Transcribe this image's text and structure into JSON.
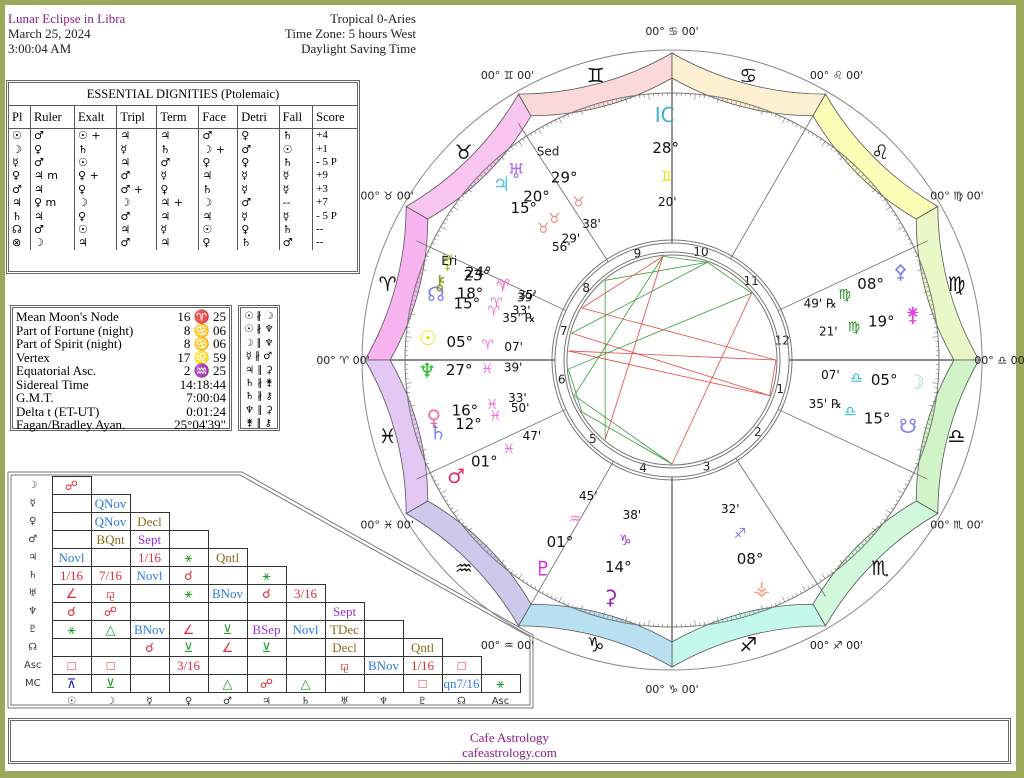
{
  "header": {
    "title": "Lunar Eclipse in Libra",
    "date": "March 25, 2024",
    "time": "3:00:04 AM",
    "zodiac": "Tropical 0-Aries",
    "timezone": "Time Zone: 5 hours West",
    "dst": "Daylight Saving Time"
  },
  "dignities": {
    "title": "ESSENTIAL DIGNITIES  (Ptolemaic)",
    "columns": [
      "Pl",
      "Ruler",
      "Exalt",
      "Tripl",
      "Term",
      "Face",
      "Detri",
      "Fall",
      "Score"
    ],
    "rows": [
      [
        "☉",
        "♂",
        "☉ +",
        "♃",
        "♃",
        "♂",
        "♀",
        "♄",
        "+4"
      ],
      [
        "☽",
        "♀",
        "♄",
        "☿",
        "♄",
        "☽ +",
        "♂",
        "☉",
        "+1"
      ],
      [
        "☿",
        "♂",
        "☉",
        "♃",
        "♂",
        "♀",
        "♀",
        "♄",
        "- 5 P"
      ],
      [
        "♀",
        "♃ m",
        "♀ +",
        "♂",
        "☿",
        "♃",
        "☿",
        "☿",
        "+9"
      ],
      [
        "♂",
        "♃",
        "♀",
        "♂ +",
        "♀",
        "♄",
        "☿",
        "☿",
        "+3"
      ],
      [
        "♃",
        "♀ m",
        "☽",
        "☽",
        "♃ +",
        "☽",
        "♂",
        "--",
        "+7"
      ],
      [
        "♄",
        "♃",
        "♀",
        "♂",
        "♃",
        "♃",
        "☿",
        "☿",
        "- 5 P"
      ],
      [
        "☊",
        "♂",
        "☉",
        "♃",
        "☿",
        "☉",
        "♀",
        "♄",
        "--"
      ],
      [
        "⊗",
        "☽",
        "♃",
        "♂",
        "♃",
        "♀",
        "♄",
        "♂",
        "--"
      ]
    ]
  },
  "info": [
    {
      "label": "Mean Moon's Node",
      "value": "16 ♈ 25"
    },
    {
      "label": "Part of Fortune (night)",
      "value": "8 ♋ 06"
    },
    {
      "label": "Part of Spirit (night)",
      "value": "8 ♋ 06"
    },
    {
      "label": "Vertex",
      "value": "17 ♌ 59"
    },
    {
      "label": "Equatorial Asc.",
      "value": "2 ♒ 25"
    },
    {
      "label": "Sidereal Time",
      "value": "14:18:44"
    },
    {
      "label": "G.M.T.",
      "value": "7:00:04"
    },
    {
      "label": "Delta t (ET-UT)",
      "value": "0:01:24"
    },
    {
      "label": "Fagan/Bradley Ayan.",
      "value": "25°04'39\""
    }
  ],
  "parallels": [
    "☉ ∦ ☽",
    "☉ ∦ ♆",
    "☽ ∥ ♆",
    "☿ ∦ ♂",
    "♃ ∥ ⚳",
    "♄ ∦ ⚵",
    "♄ ∦ ⚷",
    "♆ ∥ ⚳",
    "⚵ ∥ ⚷"
  ],
  "aspect_grid": {
    "row_labels": [
      "☽",
      "☿",
      "♀",
      "♂",
      "♃",
      "♄",
      "♅",
      "♆",
      "♇",
      "☊",
      "Asc",
      "MC"
    ],
    "col_labels": [
      "☉",
      "☽",
      "☿",
      "♀",
      "♂",
      "♃",
      "♄",
      "♅",
      "♆",
      "♇",
      "☊",
      "Asc"
    ],
    "cells": [
      [
        {
          "t": "☍",
          "c": "red"
        }
      ],
      [
        {
          "t": ""
        },
        {
          "t": "QNov",
          "c": "blu"
        }
      ],
      [
        {
          "t": ""
        },
        {
          "t": "QNov",
          "c": "blu"
        },
        {
          "t": "Decl",
          "c": "brn"
        }
      ],
      [
        {
          "t": ""
        },
        {
          "t": "BQnt",
          "c": "brn"
        },
        {
          "t": "Sept",
          "c": "pur"
        },
        {
          "t": ""
        }
      ],
      [
        {
          "t": "Novl",
          "c": "blu"
        },
        {
          "t": ""
        },
        {
          "t": "1/16",
          "c": "red"
        },
        {
          "t": "⚹",
          "c": "grn"
        },
        {
          "t": "Qntl",
          "c": "brn"
        }
      ],
      [
        {
          "t": "1/16",
          "c": "red"
        },
        {
          "t": "7/16",
          "c": "red"
        },
        {
          "t": "Novl",
          "c": "blu"
        },
        {
          "t": "☌",
          "c": "red"
        },
        {
          "t": ""
        },
        {
          "t": "⚹",
          "c": "grn"
        }
      ],
      [
        {
          "t": "∠",
          "c": "red"
        },
        {
          "t": "⚼",
          "c": "red"
        },
        {
          "t": ""
        },
        {
          "t": "⚹",
          "c": "grn"
        },
        {
          "t": "BNov",
          "c": "blu"
        },
        {
          "t": "☌",
          "c": "red"
        },
        {
          "t": "3/16",
          "c": "red"
        }
      ],
      [
        {
          "t": "☌",
          "c": "red"
        },
        {
          "t": "☍",
          "c": "red"
        },
        {
          "t": ""
        },
        {
          "t": ""
        },
        {
          "t": ""
        },
        {
          "t": ""
        },
        {
          "t": ""
        },
        {
          "t": "Sept",
          "c": "pur"
        }
      ],
      [
        {
          "t": "⚹",
          "c": "grn"
        },
        {
          "t": "△",
          "c": "grn"
        },
        {
          "t": "BNov",
          "c": "blu"
        },
        {
          "t": "∠",
          "c": "red"
        },
        {
          "t": "⊻",
          "c": "grn"
        },
        {
          "t": "BSep",
          "c": "pur"
        },
        {
          "t": "Novl",
          "c": "blu"
        },
        {
          "t": "TDec",
          "c": "brn"
        },
        {
          "t": ""
        }
      ],
      [
        {
          "t": ""
        },
        {
          "t": ""
        },
        {
          "t": "☌",
          "c": "red"
        },
        {
          "t": "⊻",
          "c": "grn"
        },
        {
          "t": "∠",
          "c": "red"
        },
        {
          "t": "⊻",
          "c": "grn"
        },
        {
          "t": ""
        },
        {
          "t": "Decl",
          "c": "brn"
        },
        {
          "t": ""
        },
        {
          "t": "Qntl",
          "c": "brn"
        }
      ],
      [
        {
          "t": "□",
          "c": "red"
        },
        {
          "t": "□",
          "c": "red"
        },
        {
          "t": ""
        },
        {
          "t": "3/16",
          "c": "red"
        },
        {
          "t": ""
        },
        {
          "t": ""
        },
        {
          "t": ""
        },
        {
          "t": "⚼",
          "c": "red"
        },
        {
          "t": "BNov",
          "c": "blu"
        },
        {
          "t": "1/16",
          "c": "red"
        },
        {
          "t": "□",
          "c": "red"
        }
      ],
      [
        {
          "t": "⊼",
          "c": "dblu"
        },
        {
          "t": "⊻",
          "c": "grn"
        },
        {
          "t": ""
        },
        {
          "t": ""
        },
        {
          "t": "△",
          "c": "grn"
        },
        {
          "t": "☍",
          "c": "red"
        },
        {
          "t": "△",
          "c": "grn"
        },
        {
          "t": ""
        },
        {
          "t": ""
        },
        {
          "t": "□",
          "c": "red"
        },
        {
          "t": "qn7/16",
          "c": "blu"
        },
        {
          "t": "⚹",
          "c": "grn"
        }
      ]
    ]
  },
  "wheel": {
    "signs": [
      {
        "name": "Aries",
        "glyph": "♈",
        "color": "#f8b4f0"
      },
      {
        "name": "Taurus",
        "glyph": "♉",
        "color": "#f8c4f0"
      },
      {
        "name": "Gemini",
        "glyph": "♊",
        "color": "#fbd9d9"
      },
      {
        "name": "Cancer",
        "glyph": "♋",
        "color": "#fdf0d0"
      },
      {
        "name": "Leo",
        "glyph": "♌",
        "color": "#fdfdb8"
      },
      {
        "name": "Virgo",
        "glyph": "♍",
        "color": "#eaf8c8"
      },
      {
        "name": "Libra",
        "glyph": "♎",
        "color": "#d0f4c8"
      },
      {
        "name": "Scorpio",
        "glyph": "♏",
        "color": "#d2f8dc"
      },
      {
        "name": "Sagittarius",
        "glyph": "♐",
        "color": "#c4f8ec"
      },
      {
        "name": "Capricorn",
        "glyph": "♑",
        "color": "#b8e0f0"
      },
      {
        "name": "Aquarius",
        "glyph": "♒",
        "color": "#cccaec"
      },
      {
        "name": "Pisces",
        "glyph": "♓",
        "color": "#e4c8f4"
      }
    ],
    "cusp_label": {
      "deg": "00°",
      "min": "00'"
    },
    "house_numbers": [
      "1",
      "2",
      "3",
      "4",
      "5",
      "6",
      "7",
      "8",
      "9",
      "10",
      "11",
      "12"
    ],
    "planets": [
      {
        "name": "Pluto",
        "glyph": "♇",
        "deg": "01°",
        "sign": "♒",
        "min": "45'",
        "color": "#e020e0",
        "sign_color": "#f070c8"
      },
      {
        "name": "Ceres",
        "glyph": "⚳",
        "deg": "14°",
        "sign": "♑",
        "min": "38'",
        "color": "#a020b0",
        "sign_color": "#9b30e0"
      },
      {
        "name": "Vesta",
        "glyph": "⚶",
        "deg": "08°",
        "sign": "♐",
        "min": "32'",
        "color": "#f8a080",
        "sign_color": "#8080f0"
      },
      {
        "name": "Mars",
        "glyph": "♂",
        "deg": "01°",
        "sign": "♓",
        "min": "47'",
        "color": "#e83060",
        "sign_color": "#f070e0"
      },
      {
        "name": "Saturn",
        "glyph": "♄",
        "deg": "12°",
        "sign": "♓",
        "min": "50'",
        "color": "#8080f0",
        "sign_color": "#f070e0"
      },
      {
        "name": "Venus",
        "glyph": "♀",
        "deg": "16°",
        "sign": "♓",
        "min": "33'",
        "color": "#f070a0",
        "sign_color": "#f070e0"
      },
      {
        "name": "Neptune",
        "glyph": "♆",
        "deg": "27°",
        "sign": "♓",
        "min": "39'",
        "color": "#20c020",
        "sign_color": "#f070e0"
      },
      {
        "name": "Sun",
        "glyph": "☉",
        "deg": "05°",
        "sign": "♈",
        "min": "07'",
        "color": "#e8e000",
        "sign_color": "#f070c8"
      },
      {
        "name": "North Node",
        "glyph": "☊",
        "deg": "15°",
        "sign": "♈",
        "min": "35'",
        "retro": "℞",
        "color": "#8080f0",
        "sign_color": "#f070c8"
      },
      {
        "name": "Chiron",
        "glyph": "⚷",
        "deg": "18°",
        "sign": "♈",
        "min": "33'",
        "color": "#80a020",
        "sign_color": "#f070c8"
      },
      {
        "name": "Mercury",
        "glyph": "☿",
        "deg": "23°",
        "sign": "♈",
        "min": "39'",
        "color": "#a0c020",
        "sign_color": "#f070c8"
      },
      {
        "name": "Eris",
        "glyph": "Eri",
        "deg": "24°",
        "sign": "♈",
        "min": "35'",
        "color": "#222",
        "sign_color": "#f070c8"
      },
      {
        "name": "Jupiter",
        "glyph": "♃",
        "deg": "15°",
        "sign": "♉",
        "min": "56'",
        "color": "#60c0f0",
        "sign_color": "#f08080"
      },
      {
        "name": "Uranus",
        "glyph": "♅",
        "deg": "20°",
        "sign": "♉",
        "min": "29'",
        "color": "#b070f0",
        "sign_color": "#f08080"
      },
      {
        "name": "Sedna",
        "glyph": "Sed",
        "deg": "29°",
        "sign": "♉",
        "min": "38'",
        "color": "#222",
        "sign_color": "#f08080"
      },
      {
        "name": "Midheaven-IC",
        "glyph": "IC",
        "deg": "28°",
        "sign": "♊",
        "min": "20'",
        "color": "#40b0d0",
        "sign_color": "#e8e000"
      },
      {
        "name": "Juno",
        "glyph": "⚵",
        "deg": "19°",
        "sign": "♍",
        "min": "21'",
        "color": "#e040e0",
        "sign_color": "#209020"
      },
      {
        "name": "Pallas",
        "glyph": "⚴",
        "deg": "08°",
        "sign": "♍",
        "min": "49'",
        "retro": "℞",
        "color": "#8080f0",
        "sign_color": "#209020"
      },
      {
        "name": "South Node",
        "glyph": "☋",
        "deg": "15°",
        "sign": "♎",
        "min": "35'",
        "retro": "℞",
        "color": "#8080f0",
        "sign_color": "#20c0d0"
      },
      {
        "name": "Moon",
        "glyph": "☽",
        "deg": "05°",
        "sign": "♎",
        "min": "07'",
        "color": "#a0d8d0",
        "sign_color": "#20c0d0"
      }
    ]
  },
  "footer": {
    "line1": "Cafe Astrology",
    "line2": "cafeastrology.com"
  }
}
